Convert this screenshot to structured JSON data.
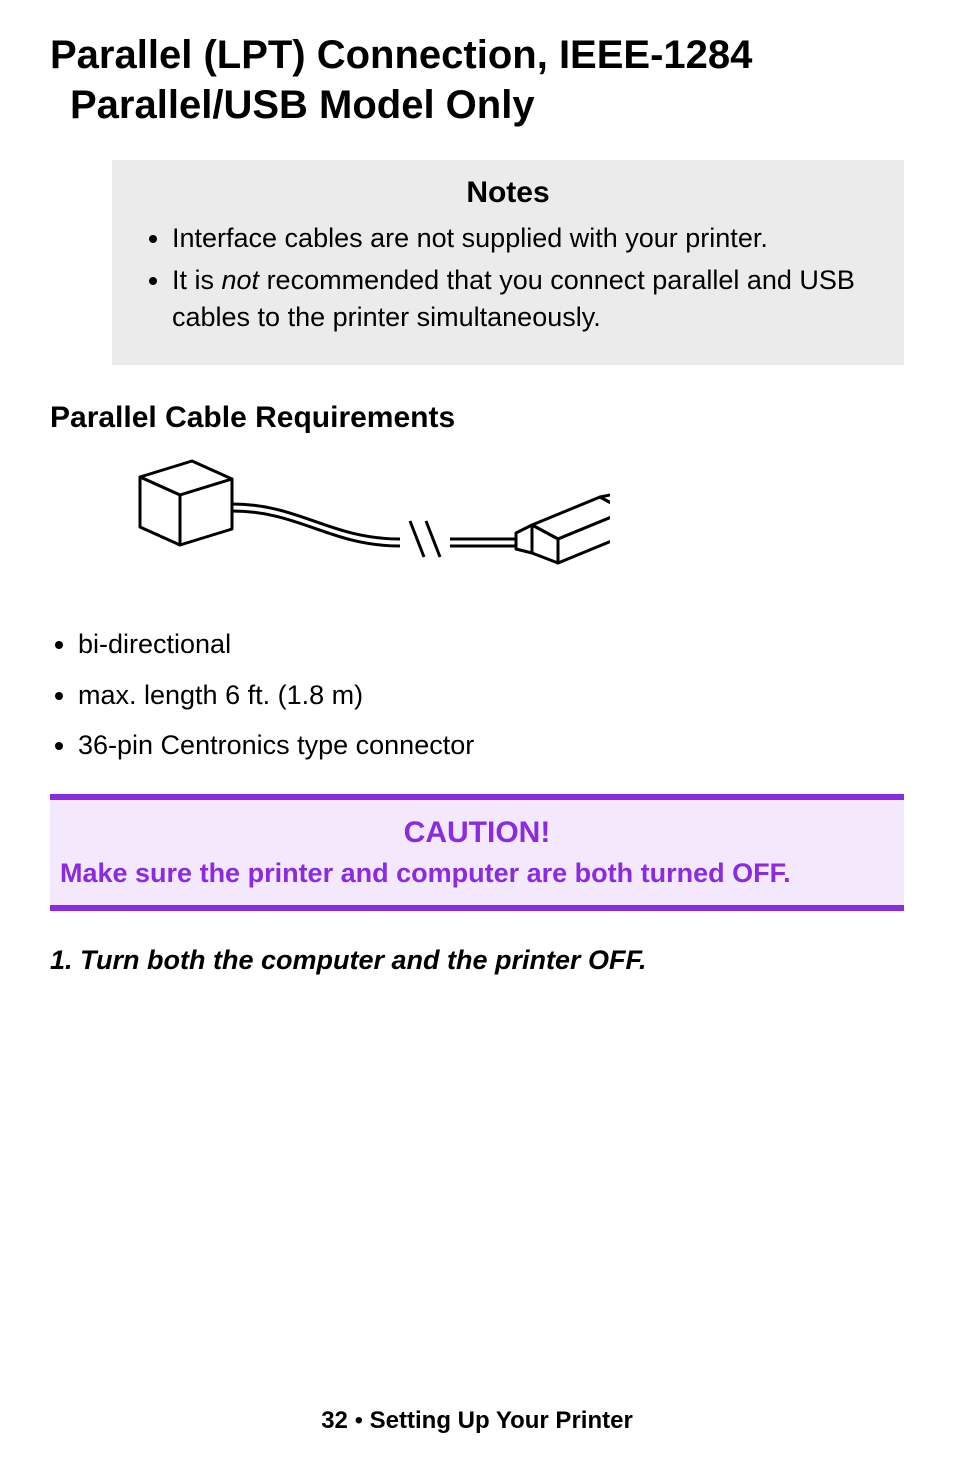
{
  "title_line1": "Parallel (LPT) Connection, IEEE-1284",
  "title_line2": "Parallel/USB Model Only",
  "notes": {
    "header": "Notes",
    "items": [
      "Interface cables are not supplied with your printer.",
      "It is <em>not</em> recommended that you connect parallel and USB cables to the printer simultaneously."
    ]
  },
  "sub_heading": "Parallel Cable Requirements",
  "requirements": [
    "bi-directional",
    "max. length 6 ft. (1.8 m)",
    "36-pin Centronics type connector"
  ],
  "caution": {
    "header": "CAUTION!",
    "text": "Make sure the printer and computer are both turned OFF."
  },
  "step1": "1. Turn both the computer and the printer OFF.",
  "footer": {
    "page": "32",
    "separator": "  •  ",
    "section": "Setting Up Your Printer"
  }
}
